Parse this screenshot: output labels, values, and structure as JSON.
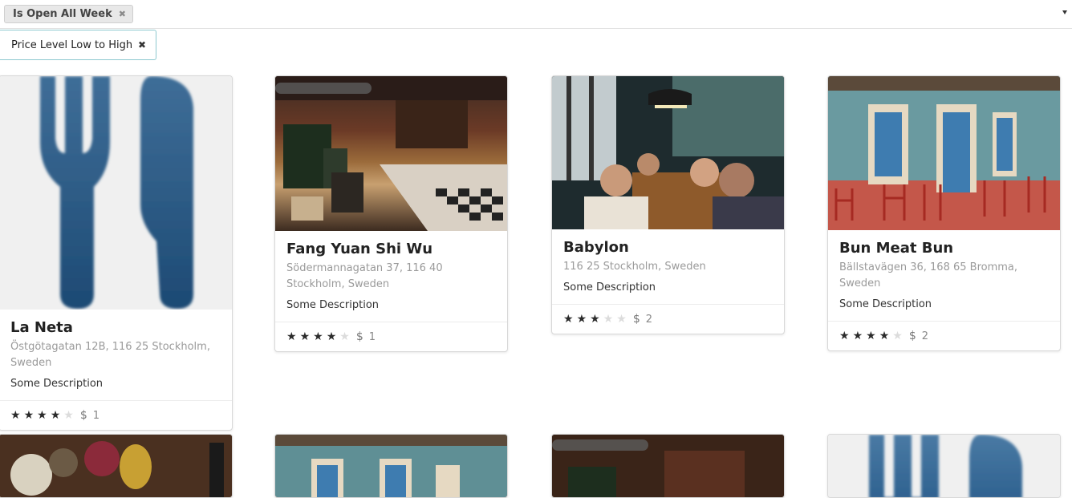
{
  "filters": {
    "chip_label": "Is Open All Week",
    "chip_remove": "✖",
    "sort_label": "Price Level Low to High",
    "sort_remove": "✖"
  },
  "cards": [
    {
      "name": "La Neta",
      "address": "Östgötagatan 12B, 116 25 Stockholm, Sweden",
      "description": "Some Description",
      "rating": 4,
      "price_symbol": "$",
      "price_level": "1",
      "image": "utensils-placeholder"
    },
    {
      "name": "Fang Yuan Shi Wu",
      "address": "Södermannagatan 37, 116 40 Stockholm, Sweden",
      "description": "Some Description",
      "rating": 4,
      "price_symbol": "$",
      "price_level": "1",
      "image": "restaurant-hall-photo"
    },
    {
      "name": "Babylon",
      "address": "116 25 Stockholm, Sweden",
      "description": "Some Description",
      "rating": 3,
      "price_symbol": "$",
      "price_level": "2",
      "image": "bar-crowd-photo"
    },
    {
      "name": "Bun Meat Bun",
      "address": "Bällstavägen 36, 168 65 Bromma, Sweden",
      "description": "Some Description",
      "rating": 4,
      "price_symbol": "$",
      "price_level": "2",
      "image": "street-cafe-photo"
    }
  ],
  "colors": {
    "utensil_dark": "#1f4f7a",
    "utensil_light": "#2f6596",
    "star_on": "#2b2b2b",
    "star_off": "#dcdcdc",
    "sort_border": "#8ec9cf"
  }
}
